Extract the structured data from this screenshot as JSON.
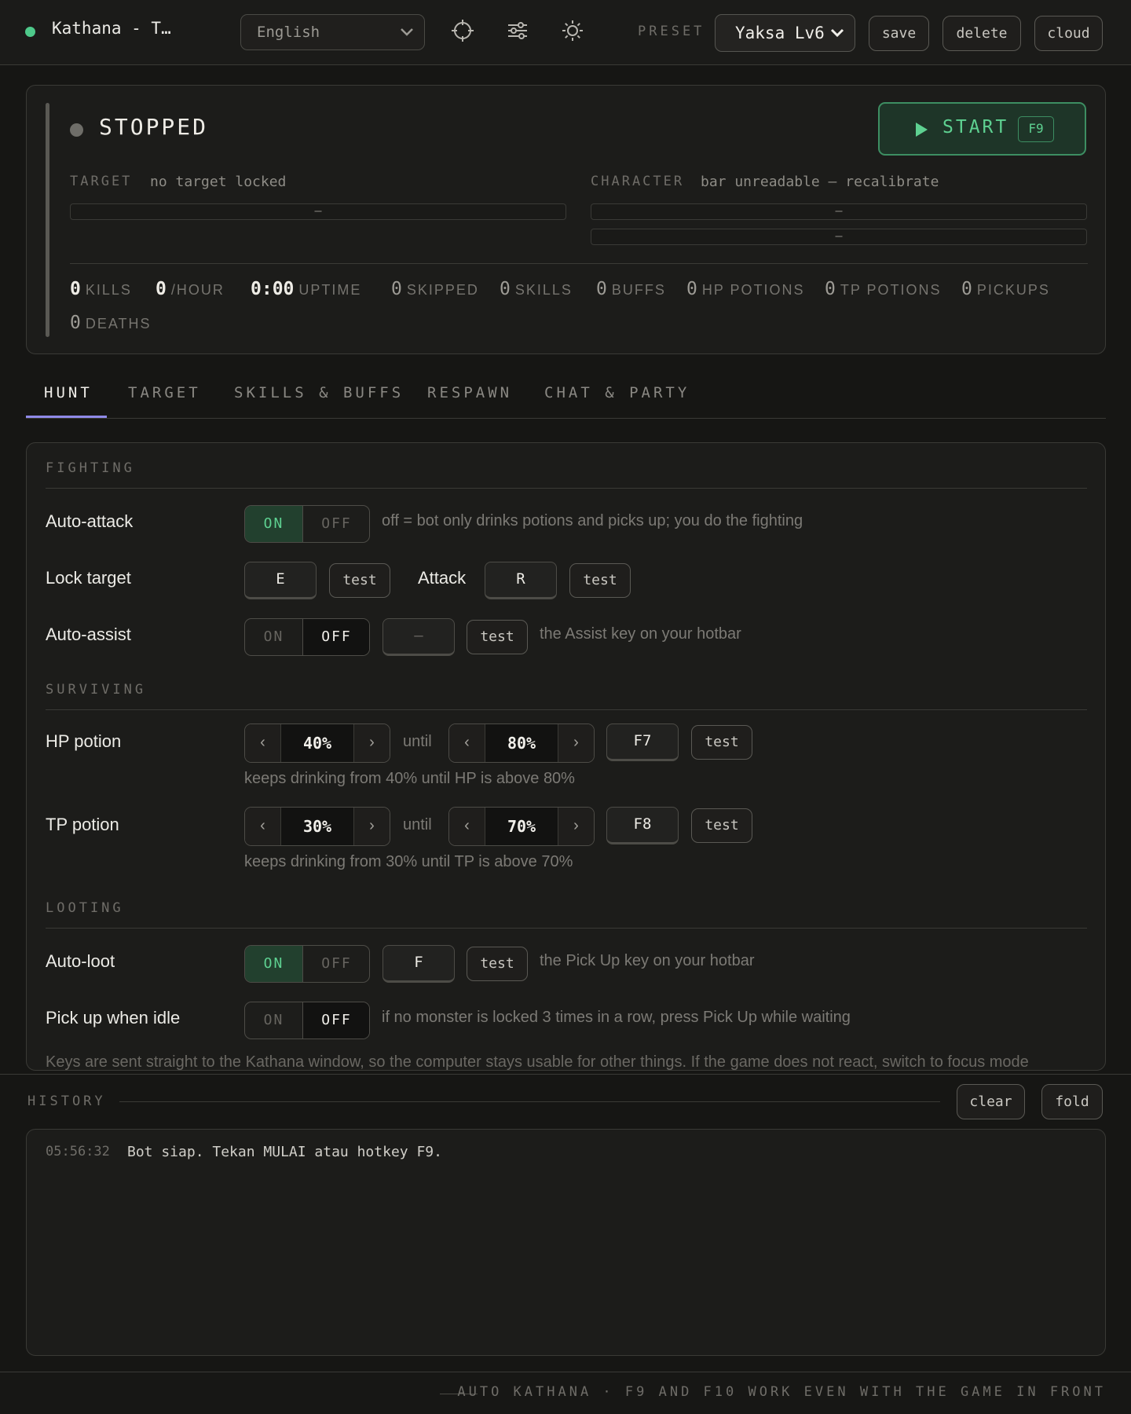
{
  "header": {
    "title": "Kathana - T…",
    "language": "English",
    "preset_label": "PRESET",
    "preset_value": "Yaksa Lv6",
    "save_label": "save",
    "delete_label": "delete",
    "cloud_label": "cloud",
    "icons": [
      "crosshair-icon",
      "sliders-icon",
      "sun-icon"
    ]
  },
  "status": {
    "state": "STOPPED",
    "start_label": "START",
    "start_hotkey": "F9",
    "target_label": "TARGET",
    "target_value": "no target locked",
    "target_bar": "–",
    "character_label": "CHARACTER",
    "character_value": "bar unreadable – recalibrate",
    "character_bar_1": "–",
    "character_bar_2": "–",
    "stats": [
      {
        "value": "0",
        "label": "KILLS"
      },
      {
        "value": "0",
        "label": "/HOUR"
      },
      {
        "value": "0:00",
        "label": "UPTIME"
      },
      {
        "value": "0",
        "label": "SKIPPED"
      },
      {
        "value": "0",
        "label": "SKILLS"
      },
      {
        "value": "0",
        "label": "BUFFS"
      },
      {
        "value": "0",
        "label": "HP POTIONS"
      },
      {
        "value": "0",
        "label": "TP POTIONS"
      },
      {
        "value": "0",
        "label": "PICKUPS"
      },
      {
        "value": "0",
        "label": "DEATHS"
      }
    ]
  },
  "tabs": [
    {
      "label": "HUNT",
      "active": true
    },
    {
      "label": "TARGET",
      "active": false
    },
    {
      "label": "SKILLS & BUFFS",
      "active": false
    },
    {
      "label": "RESPAWN",
      "active": false
    },
    {
      "label": "CHAT & PARTY",
      "active": false
    }
  ],
  "hunt": {
    "on_label": "ON",
    "off_label": "OFF",
    "test_label": "test",
    "until_label": "until",
    "fighting": {
      "heading": "FIGHTING",
      "auto_attack": {
        "label": "Auto-attack",
        "state": "ON",
        "hint": "off = bot only drinks potions and picks up; you do the fighting"
      },
      "lock_target": {
        "label": "Lock target",
        "key": "E",
        "attack_label": "Attack",
        "attack_key": "R"
      },
      "auto_assist": {
        "label": "Auto-assist",
        "state": "OFF",
        "key": "–",
        "hint": "the Assist key on your hotbar"
      }
    },
    "surviving": {
      "heading": "SURVIVING",
      "hp_potion": {
        "label": "HP potion",
        "from": "40%",
        "until": "80%",
        "key": "F7",
        "hint": "keeps drinking from 40% until HP is above 80%"
      },
      "tp_potion": {
        "label": "TP potion",
        "from": "30%",
        "until": "70%",
        "key": "F8",
        "hint": "keeps drinking from 30% until TP is above 70%"
      }
    },
    "looting": {
      "heading": "LOOTING",
      "auto_loot": {
        "label": "Auto-loot",
        "state": "ON",
        "key": "F",
        "hint": "the Pick Up key on your hotbar"
      },
      "pickup_idle": {
        "label": "Pick up when idle",
        "state": "OFF",
        "hint": "if no monster is locked 3 times in a row, press Pick Up while waiting"
      }
    },
    "footnote": "Keys are sent straight to the Kathana window, so the computer stays usable for other things. If the game does not react, switch to focus mode"
  },
  "history": {
    "title": "HISTORY",
    "clear_label": "clear",
    "fold_label": "fold",
    "entries": [
      {
        "time": "05:56:32",
        "message": "Bot siap. Tekan MULAI atau hotkey F9."
      }
    ]
  },
  "footer": {
    "text": "AUTO KATHANA · F9 AND F10 WORK EVEN WITH THE GAME IN FRONT"
  },
  "colors": {
    "accent_green": "#5ed191",
    "tab_underline": "#8f89e8",
    "status_dot_app": "#4ec98a"
  }
}
